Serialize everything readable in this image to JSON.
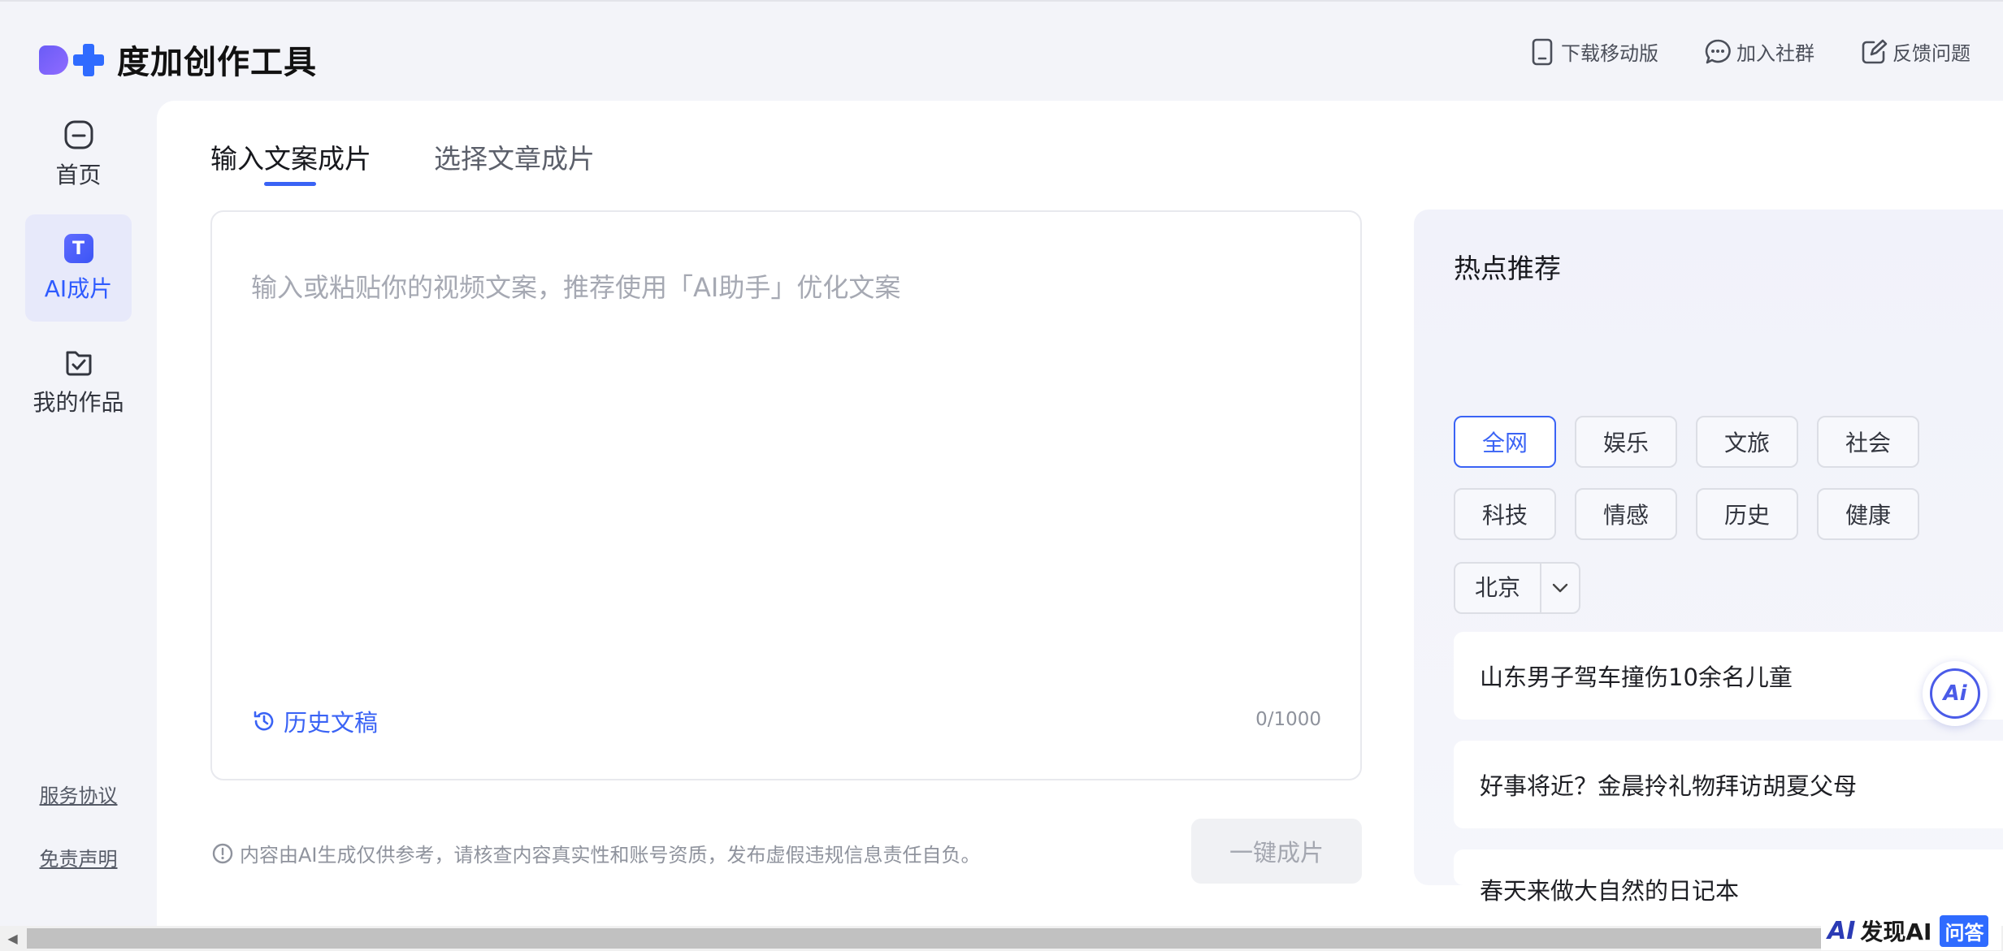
{
  "app": {
    "name": "度加创作工具"
  },
  "header": {
    "actions": [
      {
        "label": "下载移动版",
        "icon": "tablet-icon"
      },
      {
        "label": "加入社群",
        "icon": "chat-bubble-icon"
      },
      {
        "label": "反馈问题",
        "icon": "edit-box-icon"
      }
    ]
  },
  "sidebar": {
    "items": [
      {
        "label": "首页",
        "icon": "home-icon",
        "active": false
      },
      {
        "label": "AI成片",
        "icon": "ai-text-icon",
        "active": true
      },
      {
        "label": "我的作品",
        "icon": "checkbox-folder-icon",
        "active": false
      }
    ],
    "links": [
      "服务协议",
      "免责声明"
    ]
  },
  "main": {
    "tabs": [
      {
        "label": "输入文案成片",
        "active": true
      },
      {
        "label": "选择文章成片",
        "active": false
      }
    ],
    "editor": {
      "placeholder": "输入或粘贴你的视频文案，推荐使用「AI助手」优化文案",
      "value": "",
      "history_label": "历史文稿",
      "counter": "0/1000"
    },
    "disclaimer": "内容由AI生成仅供参考，请核查内容真实性和账号资质，发布虚假违规信息责任自负。",
    "generate_button": "一键成片"
  },
  "hot": {
    "title": "热点推荐",
    "categories": [
      {
        "label": "全网",
        "active": true
      },
      {
        "label": "娱乐",
        "active": false
      },
      {
        "label": "文旅",
        "active": false
      },
      {
        "label": "社会",
        "active": false
      },
      {
        "label": "科技",
        "active": false
      },
      {
        "label": "情感",
        "active": false
      },
      {
        "label": "历史",
        "active": false
      },
      {
        "label": "健康",
        "active": false
      }
    ],
    "city": "北京",
    "news": [
      "山东男子驾车撞伤10余名儿童",
      "好事将近？金晨拎礼物拜访胡夏父母",
      "春天来做大自然的日记本"
    ]
  },
  "floating": {
    "ai_assistant_label": "Ai"
  },
  "watermark": {
    "logo": "AI",
    "text": "发现AI",
    "badge": "问答"
  },
  "colors": {
    "accent": "#3a63f5",
    "background": "#f3f4f9",
    "panel": "#ffffff"
  }
}
